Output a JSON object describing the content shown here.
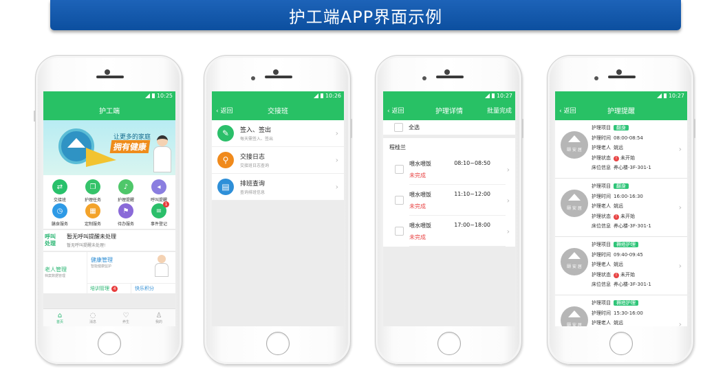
{
  "banner": {
    "title": "护工端APP界面示例"
  },
  "phones": [
    {
      "time": "10:25",
      "title": "护工端",
      "hero": {
        "line1": "让更多的家庭",
        "line2": "拥有健康"
      },
      "grid": [
        {
          "label": "交接班",
          "icon": "exchange-icon",
          "color": "#29c16b"
        },
        {
          "label": "护理任务",
          "icon": "task-icon",
          "color": "#35c36a"
        },
        {
          "label": "护理提醒",
          "icon": "bell-icon",
          "color": "#4fc76a"
        },
        {
          "label": "呼叫提醒",
          "icon": "speaker-icon",
          "color": "#8a7ee0"
        },
        {
          "label": "膳食服务",
          "icon": "clock-icon",
          "color": "#2e9ae6"
        },
        {
          "label": "定制服务",
          "icon": "basket-icon",
          "color": "#f3a32a"
        },
        {
          "label": "待办服务",
          "icon": "flag-icon",
          "color": "#8a6ad8"
        },
        {
          "label": "事件登记",
          "icon": "document-icon",
          "color": "#2bbf6a",
          "badge": "1"
        }
      ],
      "alert": {
        "tag_line1": "呼叫",
        "tag_line2": "处理",
        "title": "暂无呼叫提醒未处理",
        "subtitle": "暂无呼叫提醒未处理!"
      },
      "modules": {
        "elder_title": "老人管理",
        "elder_sub": "档案数据管理",
        "health_title": "健康管理",
        "health_sub": "智能健康监护",
        "training": "培训管理",
        "training_badge": "4",
        "points": "快乐积分"
      },
      "tabs": [
        "首页",
        "消息",
        "养生",
        "我的"
      ]
    },
    {
      "time": "10:26",
      "back": "返回",
      "title": "交接班",
      "items": [
        {
          "title": "签入、签出",
          "sub": "每天需签入、签出",
          "icon": "pen-icon",
          "color": "#2bbf6a"
        },
        {
          "title": "交接日志",
          "sub": "交接班日志查询",
          "icon": "search-icon",
          "color": "#f08a1c"
        },
        {
          "title": "排班查询",
          "sub": "查询排班信息",
          "icon": "notepad-icon",
          "color": "#2e8fd8"
        }
      ]
    },
    {
      "time": "10:27",
      "back": "返回",
      "title": "护理详情",
      "action": "批量完成",
      "select_all": "全选",
      "patient": "程桂兰",
      "tasks": [
        {
          "name": "喂水喂饭",
          "time": "08:10~08:50",
          "status": "未完成"
        },
        {
          "name": "喂水喂饭",
          "time": "11:10~12:00",
          "status": "未完成"
        },
        {
          "name": "喂水喂饭",
          "time": "17:00~18:00",
          "status": "未完成"
        }
      ]
    },
    {
      "time": "10:27",
      "back": "返回",
      "title": "护理提醒",
      "labels": {
        "item": "护理项目",
        "time": "护理时间",
        "elder": "护理老人",
        "state": "护理状态",
        "bed": "床位信息"
      },
      "logo_text": "颐 安 居",
      "reminders": [
        {
          "item": "翻身",
          "time": "08:00-08:54",
          "elder": "姚远",
          "state": "未开始",
          "bed": "养心楼-3F-301-1"
        },
        {
          "item": "翻身",
          "time": "16:00-16:30",
          "elder": "姚远",
          "state": "未开始",
          "bed": "养心楼-3F-301-1"
        },
        {
          "item": "褥疮护理",
          "time": "09:40-09:45",
          "elder": "姚远",
          "state": "未开始",
          "bed": "养心楼-3F-301-1"
        },
        {
          "item": "褥疮护理",
          "time": "15:30-16:00",
          "elder": "姚远",
          "state": "",
          "bed": ""
        }
      ]
    }
  ]
}
